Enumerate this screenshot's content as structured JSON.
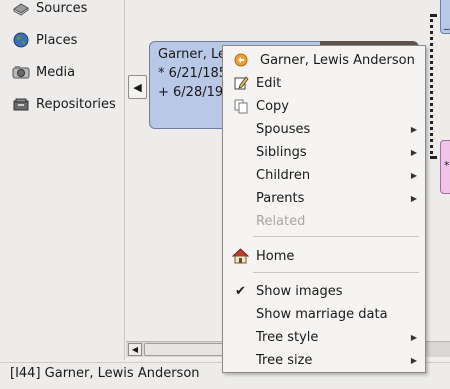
{
  "sidebar": {
    "items": [
      {
        "label": "Sources",
        "icon": "sources-icon"
      },
      {
        "label": "Places",
        "icon": "globe-icon"
      },
      {
        "label": "Media",
        "icon": "camera-icon"
      },
      {
        "label": "Repositories",
        "icon": "repository-icon"
      }
    ]
  },
  "chart": {
    "nav_arrow": "◀",
    "person": {
      "name": "Garner, Le",
      "birth": "* 6/21/185",
      "death": "+ 6/28/191"
    },
    "right_top_mark": "_",
    "right_bottom_mark": "*"
  },
  "context_menu": {
    "header": "Garner, Lewis Anderson",
    "items": [
      {
        "label": "Edit",
        "icon": "edit-icon",
        "submenu": false
      },
      {
        "label": "Copy",
        "icon": "copy-icon",
        "submenu": false
      },
      {
        "label": "Spouses",
        "submenu": true
      },
      {
        "label": "Siblings",
        "submenu": true
      },
      {
        "label": "Children",
        "submenu": true
      },
      {
        "label": "Parents",
        "submenu": true
      },
      {
        "label": "Related",
        "submenu": false,
        "disabled": true
      }
    ],
    "home": "Home",
    "show_images": "Show images",
    "show_images_checked": true,
    "show_marriage": "Show marriage data",
    "tree_style": "Tree style",
    "tree_size": "Tree size"
  },
  "statusbar": {
    "text": "[I44]  Garner, Lewis Anderson"
  }
}
